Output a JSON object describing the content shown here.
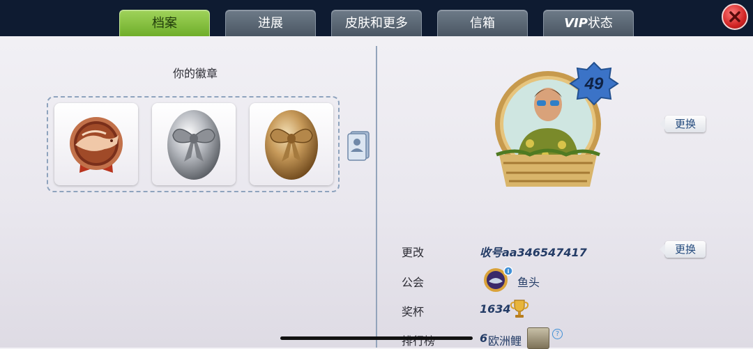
{
  "tabs": [
    {
      "label": "档案",
      "active": true
    },
    {
      "label": "进展"
    },
    {
      "label": "皮肤和更多"
    },
    {
      "label": "信箱"
    },
    {
      "label_bold": "VIP",
      "label_rest": "状态"
    }
  ],
  "badges": {
    "title": "你的徽章",
    "items": [
      {
        "name": "fish-medal"
      },
      {
        "name": "silver-egg"
      },
      {
        "name": "bronze-egg"
      }
    ]
  },
  "profile": {
    "level": "49",
    "change_avatar_label": "更换",
    "change_label": "更改",
    "account_name": "收号aa346547417",
    "change_name_label": "更换",
    "guild_label": "公会",
    "guild_name": "鱼头",
    "trophy_label": "奖杯",
    "trophy_count": "1634",
    "ranking_label": "排行榜",
    "ranking_value": "6",
    "ranking_region": "欧洲鲤"
  },
  "colors": {
    "topbar": "#0e1b31",
    "active_tab": "#8ac548",
    "tab": "#5a6674",
    "accent_text": "#243c66"
  }
}
